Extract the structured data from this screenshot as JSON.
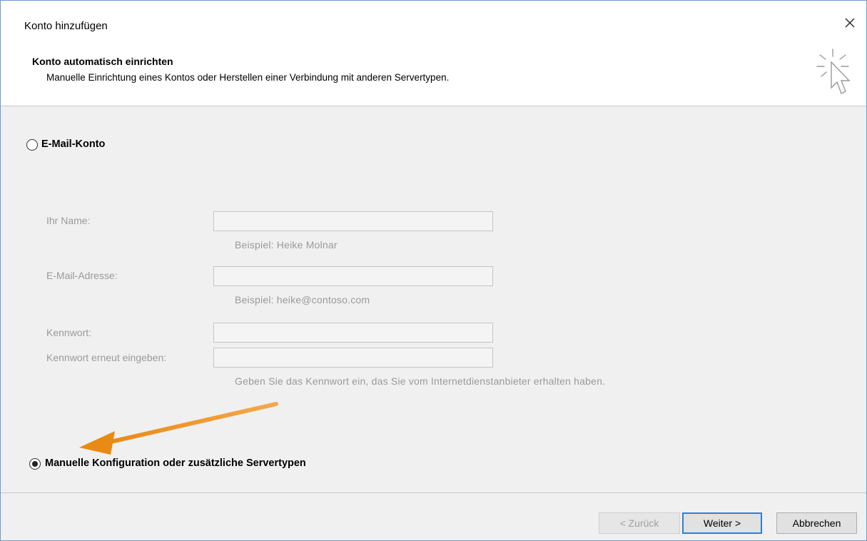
{
  "window": {
    "title": "Konto hinzufügen",
    "close_label": "✕"
  },
  "header": {
    "title": "Konto automatisch einrichten",
    "subtitle": "Manuelle Einrichtung eines Kontos oder Herstellen einer Verbindung mit anderen Servertypen.",
    "icon": "cursor-sparkle-icon"
  },
  "options": {
    "email_account": {
      "label": "E-Mail-Konto",
      "selected": false
    },
    "manual_config": {
      "label": "Manuelle Konfiguration oder zusätzliche Servertypen",
      "selected": true
    }
  },
  "form": {
    "name": {
      "label": "Ihr Name:",
      "value": "",
      "hint": "Beispiel: Heike Molnar"
    },
    "email": {
      "label": "E-Mail-Adresse:",
      "value": "",
      "hint": "Beispiel: heike@contoso.com"
    },
    "password": {
      "label": "Kennwort:",
      "value": ""
    },
    "password_repeat": {
      "label": "Kennwort erneut eingeben:",
      "value": "",
      "hint": "Geben Sie das Kennwort ein, das Sie vom Internetdienstanbieter erhalten haben."
    },
    "disabled": true
  },
  "annotation": {
    "color": "#f0901e",
    "icon": "orange-arrow"
  },
  "buttons": {
    "back": "< Zurück",
    "next": "Weiter >",
    "cancel": "Abbrechen"
  },
  "colors": {
    "accent": "#2f7fd6",
    "window_border": "#6b9bd1"
  }
}
